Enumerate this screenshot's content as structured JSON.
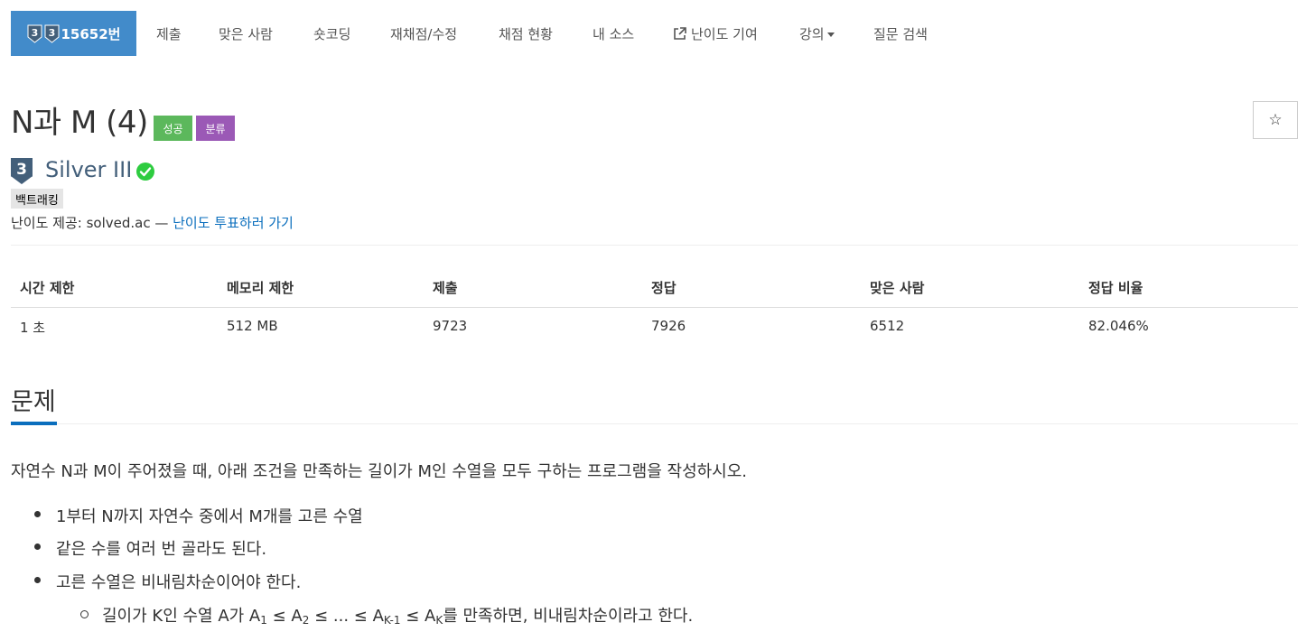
{
  "nav": {
    "problem_number": "15652번",
    "items": [
      "제출",
      "맞은 사람",
      "숏코딩",
      "재채점/수정",
      "채점 현황",
      "내 소스",
      "난이도 기여",
      "강의",
      "질문 검색"
    ]
  },
  "problem": {
    "title": "N과 M (4)",
    "badge_success": "성공",
    "badge_category": "분류",
    "tier_digit": "3",
    "tier_name": "Silver III",
    "tag": "백트래킹",
    "difficulty_prefix": "난이도 제공: solved.ac — ",
    "difficulty_link": "난이도 투표하러 가기",
    "star": "☆"
  },
  "info_table": {
    "headers": [
      "시간 제한",
      "메모리 제한",
      "제출",
      "정답",
      "맞은 사람",
      "정답 비율"
    ],
    "values": [
      "1 초",
      "512 MB",
      "9723",
      "7926",
      "6512",
      "82.046%"
    ]
  },
  "section": {
    "title": "문제",
    "description": "자연수 N과 M이 주어졌을 때, 아래 조건을 만족하는 길이가 M인 수열을 모두 구하는 프로그램을 작성하시오.",
    "conditions": [
      "1부터 N까지 자연수 중에서 M개를 고른 수열",
      "같은 수를 여러 번 골라도 된다.",
      "고른 수열은 비내림차순이어야 한다."
    ],
    "sub_condition": {
      "p1": "길이가 K인 수열 A가 A",
      "s1": "1",
      "p2": " ≤ A",
      "s2": "2",
      "p3": " ≤ ... ≤ A",
      "s3": "K-1",
      "p4": " ≤ A",
      "s4": "K",
      "p5": "를 만족하면, 비내림차순이라고 한다."
    }
  },
  "colors": {
    "nav_active": "#428bca",
    "success": "#5cb85c",
    "category": "#9b59b6",
    "tier_silver": "#435f7a",
    "link": "#0a6ebd",
    "check": "#2ecc40"
  }
}
